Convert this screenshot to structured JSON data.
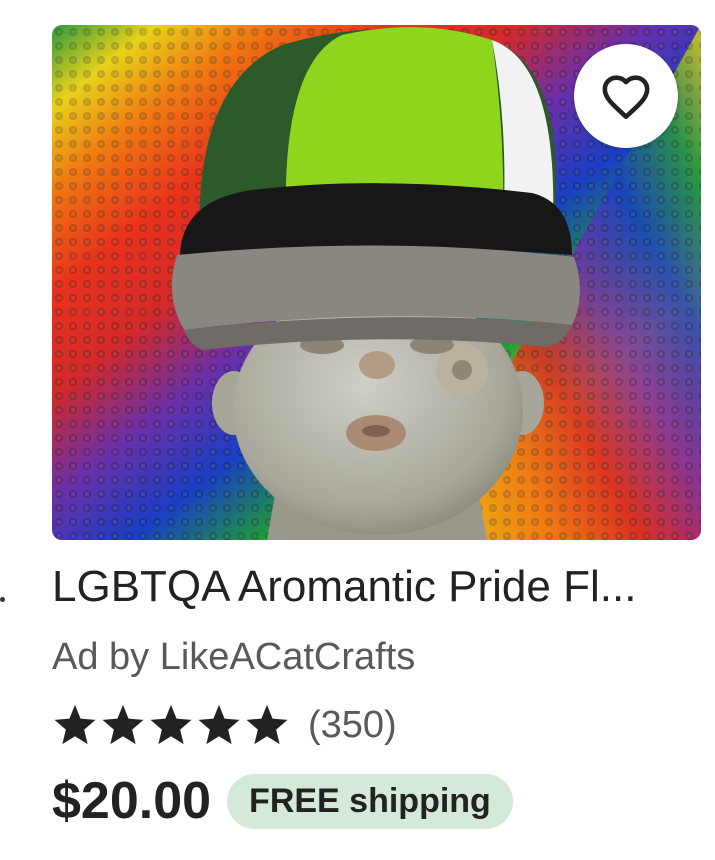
{
  "listing": {
    "title": "LGBTQA Aromantic Pride Fl...",
    "seller_line": "Ad by LikeACatCrafts",
    "rating": 5,
    "review_count": "(350)",
    "price": "$20.00",
    "shipping_badge": "FREE shipping"
  },
  "icons": {
    "favorite": "heart-outline-icon",
    "star": "star-filled-icon"
  },
  "colors": {
    "badge_bg": "#d4e9d7",
    "text_primary": "#222222",
    "text_secondary": "#595959",
    "hat_green_light": "#8ed61e",
    "hat_green_dark": "#2d5a2a"
  }
}
